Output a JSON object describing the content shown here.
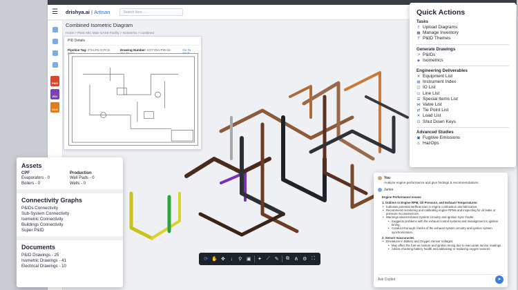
{
  "app": {
    "brand": "drishya.ai",
    "brand_sub": "Artisan",
    "search_placeholder": "Search here ...",
    "title": "Combined Isometric Diagram",
    "breadcrumb": "Home  >  Plant ABC Main GASB Facility  >  Isometrics  >  combined"
  },
  "pid_panel": {
    "header": "PID Details",
    "pipeline_tag_label": "Pipeline Tag:",
    "pipeline_tag": "2\"3-LPS-X-FCS-0008",
    "drawing_label": "Drawing Number:",
    "drawing_number": "XXYYDA-PID-01-011-01",
    "goto_label": "Go To P&ID"
  },
  "rail_files": [
    {
      "label": "P&ID",
      "color": "#d8482b"
    },
    {
      "label": "ISO",
      "color": "#7b3fb7"
    },
    {
      "label": "CAD",
      "color": "#e07b1f"
    }
  ],
  "toolbar": [
    "rotate-icon",
    "pan-icon",
    "move-icon",
    "move-down-icon",
    "zoom-icon",
    "camera-icon",
    "wand-icon",
    "measure-icon",
    "marker-icon",
    "layers-icon",
    "tree-icon",
    "settings-icon",
    "fullscreen-icon"
  ],
  "quick_actions": {
    "title": "Quick Actions",
    "sections": [
      {
        "heading": "Tasks",
        "items": [
          {
            "label": "Upload Diagrams",
            "icon": "⇪"
          },
          {
            "label": "Manage Inventory",
            "icon": "▦"
          },
          {
            "label": "P&ID Themes",
            "icon": "T"
          }
        ]
      },
      {
        "heading": "Generate Drawings",
        "items": [
          {
            "label": "P&IDs",
            "icon": "↗"
          },
          {
            "label": "Isometrics",
            "icon": "◈"
          }
        ]
      },
      {
        "heading": "Engineering Deliverables",
        "items": [
          {
            "label": "Equipment List",
            "icon": "✕"
          },
          {
            "label": "Instrument Index",
            "icon": "▤"
          },
          {
            "label": "IO List",
            "icon": "◫"
          },
          {
            "label": "Line List",
            "icon": "▭"
          },
          {
            "label": "Special Items List",
            "icon": "☰"
          },
          {
            "label": "Valve List",
            "icon": "⋈"
          },
          {
            "label": "Tie Point List",
            "icon": "⇄"
          },
          {
            "label": "Load List",
            "icon": "✕"
          },
          {
            "label": "Shut Down Keys",
            "icon": "⏻"
          }
        ]
      },
      {
        "heading": "Advanced Studies",
        "items": [
          {
            "label": "Fugitive Emissions",
            "icon": "▣"
          },
          {
            "label": "HazOps",
            "icon": "⚠"
          }
        ]
      }
    ]
  },
  "assets": {
    "title": "Assets",
    "cpf": {
      "heading": "CPF",
      "rows": [
        "Evaporators - 0",
        "Boilers - 0"
      ]
    },
    "production": {
      "heading": "Production",
      "rows": [
        "Well Pads - 0",
        "Wells - 0"
      ]
    }
  },
  "connectivity": {
    "title": "Connectivity Graphs",
    "items": [
      "P&IDs Connectivity",
      "Sub-System Connectivity",
      "Isometric Connectivity",
      "Buildings Connectivity",
      "Super P&ID"
    ]
  },
  "documents": {
    "title": "Documents",
    "items": [
      "P&ID Drawings - 25",
      "Isometric Drawings - 41",
      "Electrical Drawings - 10"
    ]
  },
  "copilot": {
    "user_name": "You",
    "user_prompt": "Analyze engine performance and give findings & recommendations.",
    "bot_name": "Junior",
    "heading": "Engine Performance Issues:",
    "s1": "1. Outliers in Engine RPM, Oil Pressure, and Exhaust Temperatures:",
    "s1_items": [
      "Indicates potential inefficiencies in engine combustion and lubrication.",
      "Recommend monitoring and calibrating engine RPMs and inspecting for oil leaks or pressure inconsistencies.",
      "Warnings about Exhaust System Circuitry and Ignition Sync Faults:"
    ],
    "s1_sub": [
      "Suggests problems with the exhaust control systems and misalignment in ignition timing.",
      "Conduct thorough checks of the exhaust system circuitry and ignition system synchronization."
    ],
    "s2": "2. Sensor Inaccuracies",
    "s2_items": [
      "Deviations in Battery and Oxygen Sensor Voltages:"
    ],
    "s2_sub": [
      "May affect the fuel-air mixture and ignition timing due to inaccurate sensor readings.",
      "Advise checking battery health and calibrating or replacing oxygen sensors"
    ],
    "input_placeholder": "Ask Copilot"
  }
}
